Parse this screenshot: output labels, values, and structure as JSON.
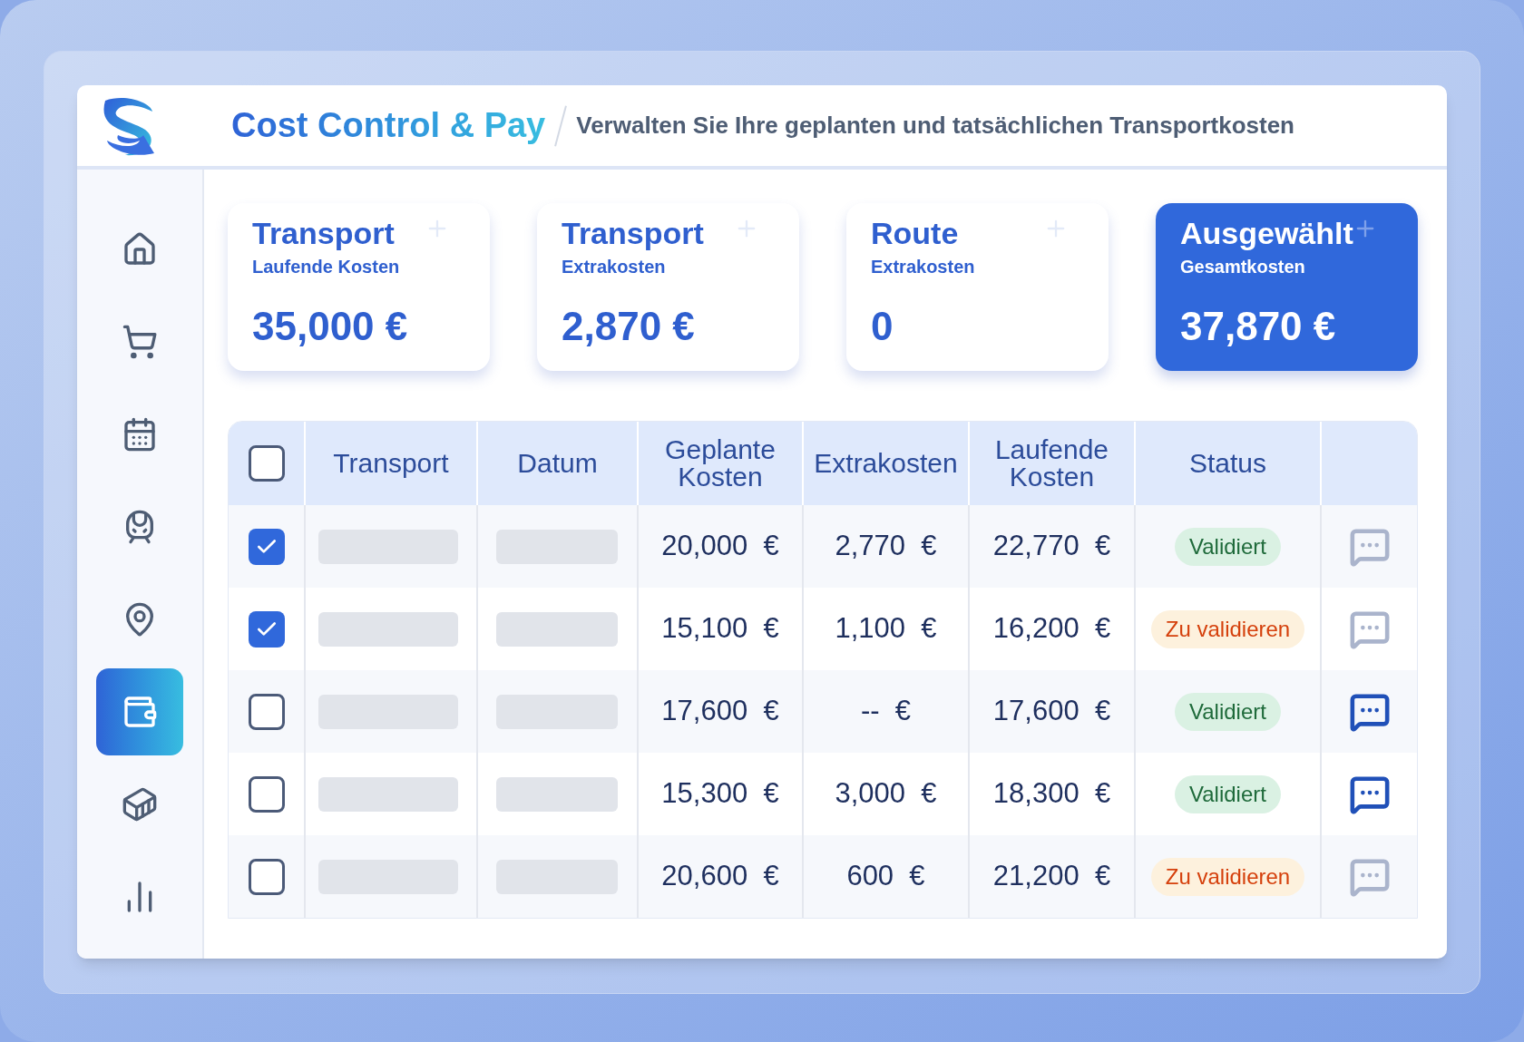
{
  "header": {
    "title_parts": [
      {
        "text": "Cost Control & Pay"
      }
    ],
    "subtitle": "Verwalten Sie Ihre geplanten und tatsächlichen Transportkosten"
  },
  "sidebar": {
    "items": [
      {
        "kind": "home",
        "selected": false
      },
      {
        "kind": "cart",
        "selected": false
      },
      {
        "kind": "calendar",
        "selected": false
      },
      {
        "kind": "train",
        "selected": false
      },
      {
        "kind": "location",
        "selected": false
      },
      {
        "kind": "wallet",
        "selected": true
      },
      {
        "kind": "container",
        "selected": false
      },
      {
        "kind": "chart",
        "selected": false
      }
    ]
  },
  "cards": [
    {
      "title": "Transport",
      "subtitle": "Laufende Kosten",
      "value": "35,000 €",
      "selected": false
    },
    {
      "title": "Transport",
      "subtitle": "Extrakosten",
      "value": "2,870 €",
      "selected": false
    },
    {
      "title": "Route",
      "subtitle": "Extrakosten",
      "value": "0",
      "selected": false
    },
    {
      "title": "Ausgewählt",
      "subtitle": "Gesamtkosten",
      "value": "37,870 €",
      "selected": true
    }
  ],
  "table": {
    "all_checked": false,
    "columns": [
      "Transport",
      "Datum",
      "Geplante Kosten",
      "Extrakosten",
      "Laufende Kosten",
      "Status"
    ],
    "rows": [
      {
        "checked": true,
        "planned": "20,000  €",
        "extra": "2,770  €",
        "running": "22,770  €",
        "status": "Validiert",
        "kind": "validated",
        "has_comments": false
      },
      {
        "checked": true,
        "planned": "15,100  €",
        "extra": "1,100  €",
        "running": "16,200  €",
        "status": "Zu validieren",
        "kind": "pending",
        "has_comments": false
      },
      {
        "checked": false,
        "planned": "17,600  €",
        "extra": "--  €",
        "running": "17,600  €",
        "status": "Validiert",
        "kind": "validated",
        "has_comments": true
      },
      {
        "checked": false,
        "planned": "15,300  €",
        "extra": "3,000  €",
        "running": "18,300  €",
        "status": "Validiert",
        "kind": "validated",
        "has_comments": true
      },
      {
        "checked": false,
        "planned": "20,600  €",
        "extra": "600  €",
        "running": "21,200  €",
        "status": "Zu validieren",
        "kind": "pending",
        "has_comments": false
      }
    ]
  }
}
